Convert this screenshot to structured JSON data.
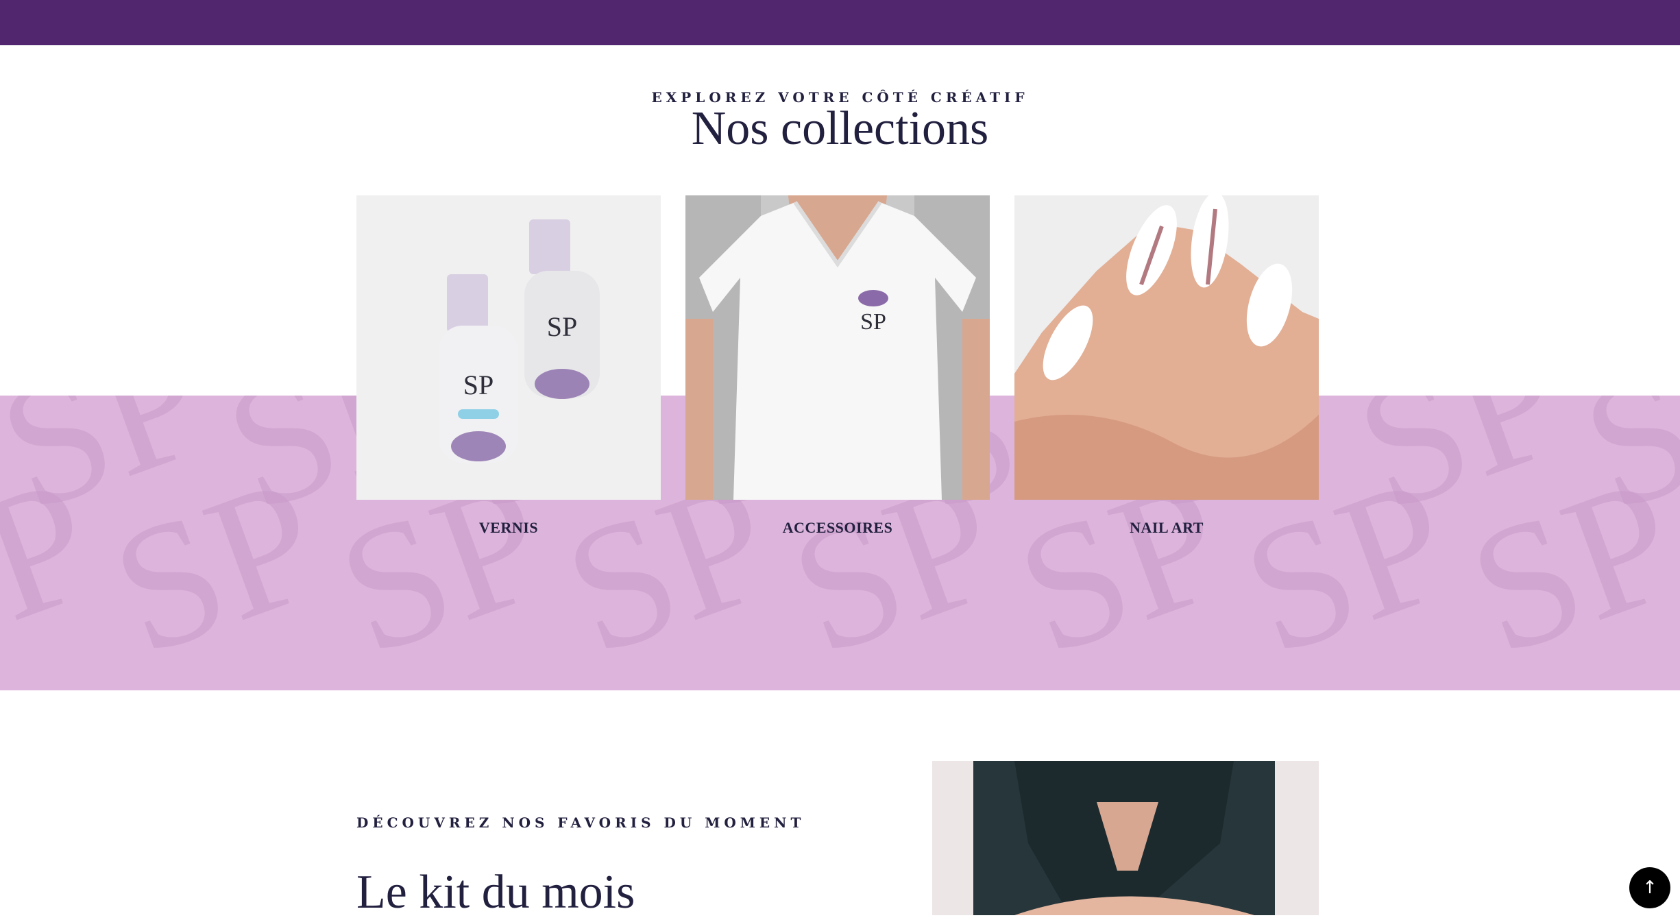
{
  "collections": {
    "eyebrow": "EXPLOREZ VOTRE CÔTÉ CRÉATIF",
    "title": "Nos collections",
    "items": [
      {
        "label": "VERNIS",
        "image_icon": "nail-polish-bottles-image",
        "bottle_text": "SP"
      },
      {
        "label": "ACCESSOIRES",
        "image_icon": "tshirt-image",
        "shirt_text": "SP"
      },
      {
        "label": "NAIL ART",
        "image_icon": "painted-nails-image"
      }
    ]
  },
  "pattern": {
    "text": "SP"
  },
  "feature": {
    "eyebrow": "DÉCOUVREZ NOS FAVORIS DU MOMENT",
    "title": "Le kit du mois"
  },
  "scroll_top": {
    "glyph": "↑",
    "icon": "arrow-up-icon"
  },
  "colors": {
    "header": "#52266e",
    "band": "#ddb4db",
    "text": "#22203f",
    "scroll_button": "#000000"
  }
}
